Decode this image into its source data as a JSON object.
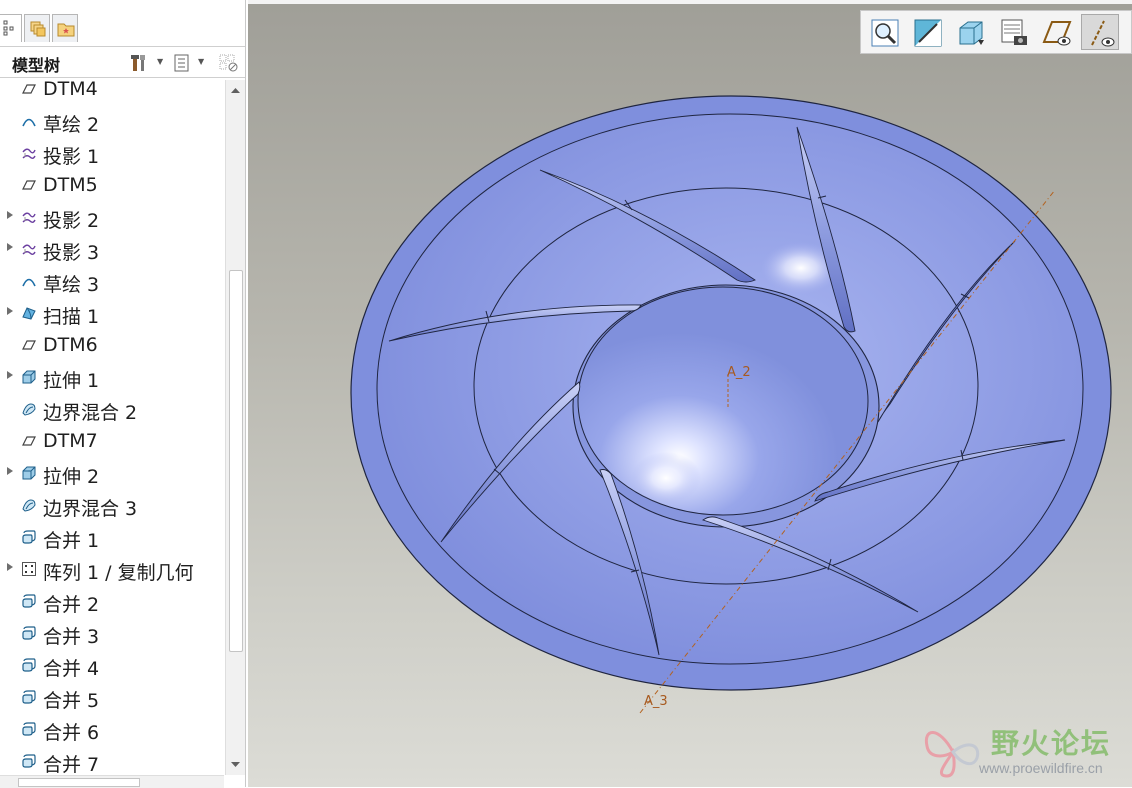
{
  "left_panel": {
    "tabs": [
      {
        "name": "model-tree-tab",
        "icon": "tree-icon"
      },
      {
        "name": "layers-tab",
        "icon": "layers-icon"
      },
      {
        "name": "favorites-tab",
        "icon": "folder-star-icon"
      }
    ],
    "tree_title": "模型树",
    "header_icons": [
      "tools-icon",
      "list-icon",
      "filter-icon"
    ],
    "tree_items": [
      {
        "label": "DTM4",
        "icon": "datum-plane-icon",
        "expandable": false
      },
      {
        "label": "草绘 2",
        "icon": "sketch-icon",
        "expandable": false
      },
      {
        "label": "投影 1",
        "icon": "projection-icon",
        "expandable": false
      },
      {
        "label": "DTM5",
        "icon": "datum-plane-icon",
        "expandable": false
      },
      {
        "label": "投影 2",
        "icon": "projection-icon",
        "expandable": true
      },
      {
        "label": "投影 3",
        "icon": "projection-icon",
        "expandable": true
      },
      {
        "label": "草绘 3",
        "icon": "sketch-icon",
        "expandable": false
      },
      {
        "label": "扫描 1",
        "icon": "sweep-icon",
        "expandable": true
      },
      {
        "label": "DTM6",
        "icon": "datum-plane-icon",
        "expandable": false
      },
      {
        "label": "拉伸 1",
        "icon": "extrude-icon",
        "expandable": true
      },
      {
        "label": "边界混合 2",
        "icon": "boundary-blend-icon",
        "expandable": false
      },
      {
        "label": "DTM7",
        "icon": "datum-plane-icon",
        "expandable": false
      },
      {
        "label": "拉伸 2",
        "icon": "extrude-icon",
        "expandable": true
      },
      {
        "label": "边界混合 3",
        "icon": "boundary-blend-icon",
        "expandable": false
      },
      {
        "label": "合并 1",
        "icon": "merge-icon",
        "expandable": false
      },
      {
        "label": "阵列 1 / 复制几何",
        "icon": "pattern-icon",
        "expandable": true
      },
      {
        "label": "合并 2",
        "icon": "merge-icon",
        "expandable": false
      },
      {
        "label": "合并 3",
        "icon": "merge-icon",
        "expandable": false
      },
      {
        "label": "合并 4",
        "icon": "merge-icon",
        "expandable": false
      },
      {
        "label": "合并 5",
        "icon": "merge-icon",
        "expandable": false
      },
      {
        "label": "合并 6",
        "icon": "merge-icon",
        "expandable": false
      },
      {
        "label": "合并 7",
        "icon": "merge-icon",
        "expandable": false
      }
    ]
  },
  "view_toolbar": [
    {
      "icon": "zoom-icon",
      "pressed": false
    },
    {
      "icon": "repaint-icon",
      "pressed": false
    },
    {
      "icon": "saved-views-icon",
      "pressed": false
    },
    {
      "icon": "view-manager-icon",
      "pressed": false
    },
    {
      "icon": "datum-plane-display-icon",
      "pressed": false
    },
    {
      "icon": "datum-axis-display-icon",
      "pressed": true
    }
  ],
  "viewport": {
    "axis_labels": [
      "A_2",
      "A_3"
    ],
    "colors": {
      "model_fill": "#8c9be0",
      "model_edge": "#1f2540",
      "axis_line": "#b3621f",
      "background_top": "#a09f98",
      "background_bottom": "#dcdcd6"
    }
  },
  "watermark": {
    "title": "野火论坛",
    "url": "www.proewildfire.cn"
  }
}
